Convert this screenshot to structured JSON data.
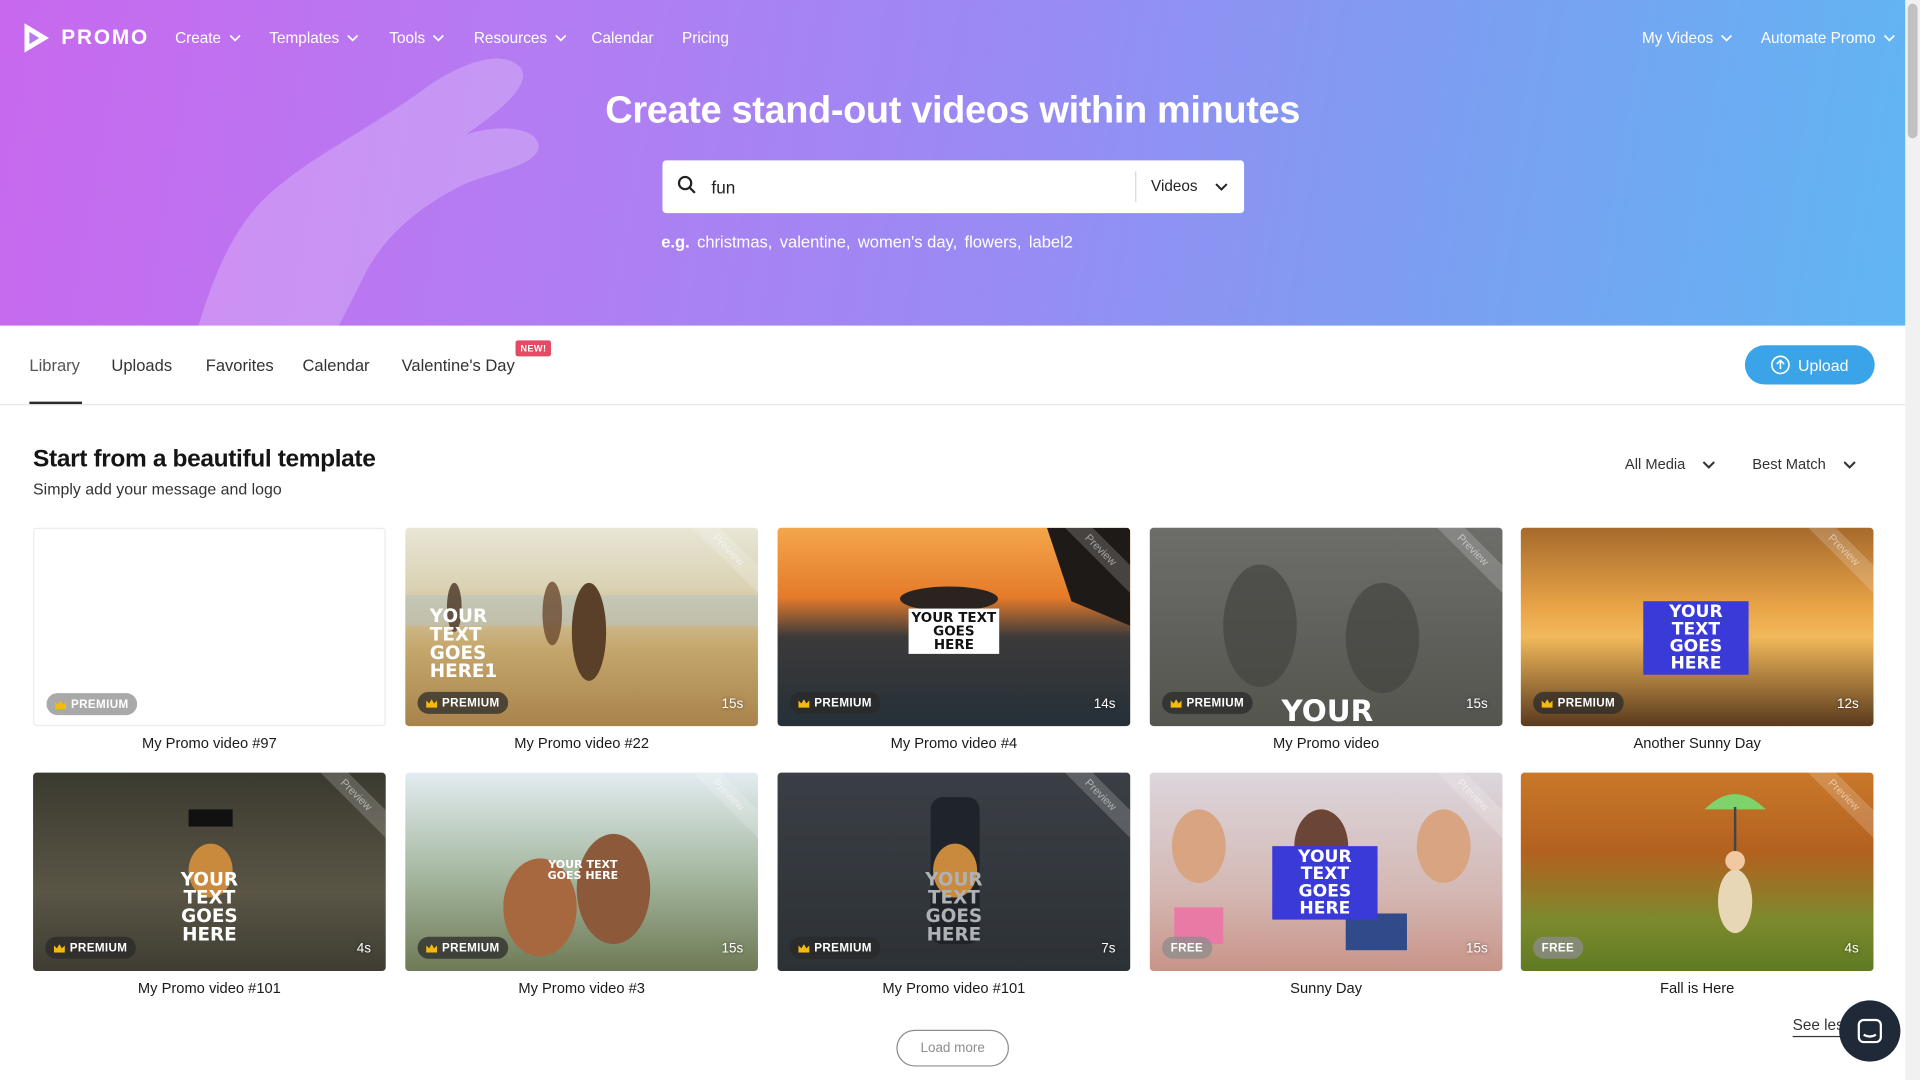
{
  "brand": {
    "name": "PROMO"
  },
  "nav": {
    "create": "Create",
    "templates": "Templates",
    "tools": "Tools",
    "resources": "Resources",
    "calendar": "Calendar",
    "pricing": "Pricing",
    "my_videos": "My Videos",
    "automate": "Automate Promo"
  },
  "hero": {
    "title": "Create stand-out videos within minutes"
  },
  "search": {
    "value": "fun",
    "type": "Videos"
  },
  "examples": {
    "prefix": "e.g.",
    "items": [
      "christmas,",
      "valentine,",
      "women's day,",
      "flowers,",
      "label2"
    ]
  },
  "tabs": {
    "library": "Library",
    "uploads": "Uploads",
    "favorites": "Favorites",
    "calendar": "Calendar",
    "valentines": "Valentine's Day",
    "new_badge": "NEW!",
    "upload": "Upload"
  },
  "section": {
    "title": "Start from a beautiful template",
    "subtitle": "Simply add your message and logo",
    "filter_media": "All Media",
    "filter_sort": "Best Match"
  },
  "cards": [
    {
      "title": "My Promo video #97",
      "badge": "PREMIUM",
      "duration": "",
      "overlay": ""
    },
    {
      "title": "My Promo video #22",
      "badge": "PREMIUM",
      "duration": "15s",
      "overlay": "YOUR TEXT GOES HERE1"
    },
    {
      "title": "My Promo video #4",
      "badge": "PREMIUM",
      "duration": "14s",
      "overlay": "YOUR TEXT GOES HERE"
    },
    {
      "title": "My Promo video",
      "badge": "PREMIUM",
      "duration": "15s",
      "overlay": "YOUR TEXT"
    },
    {
      "title": "Another Sunny Day",
      "badge": "PREMIUM",
      "duration": "12s",
      "overlay": "YOUR TEXT GOES HERE"
    },
    {
      "title": "My Promo video #101",
      "badge": "PREMIUM",
      "duration": "4s",
      "overlay": "YOUR TEXT GOES HERE"
    },
    {
      "title": "My Promo video #3",
      "badge": "PREMIUM",
      "duration": "15s",
      "overlay": "YOUR TEXT GOES HERE"
    },
    {
      "title": "My Promo video #101",
      "badge": "PREMIUM",
      "duration": "7s",
      "overlay": "YOUR TEXT GOES HERE"
    },
    {
      "title": "Sunny Day",
      "badge": "FREE",
      "duration": "15s",
      "overlay": "YOUR TEXT GOES HERE"
    },
    {
      "title": "Fall is Here",
      "badge": "FREE",
      "duration": "4s",
      "overlay": ""
    }
  ],
  "ribbon": "Preview",
  "footer": {
    "load_more": "Load more",
    "see_less": "See less"
  },
  "colors": {
    "accent": "#3ba4e8",
    "badge_new": "#e34a63",
    "hero_start": "#c868ee",
    "hero_end": "#60b6f2"
  }
}
